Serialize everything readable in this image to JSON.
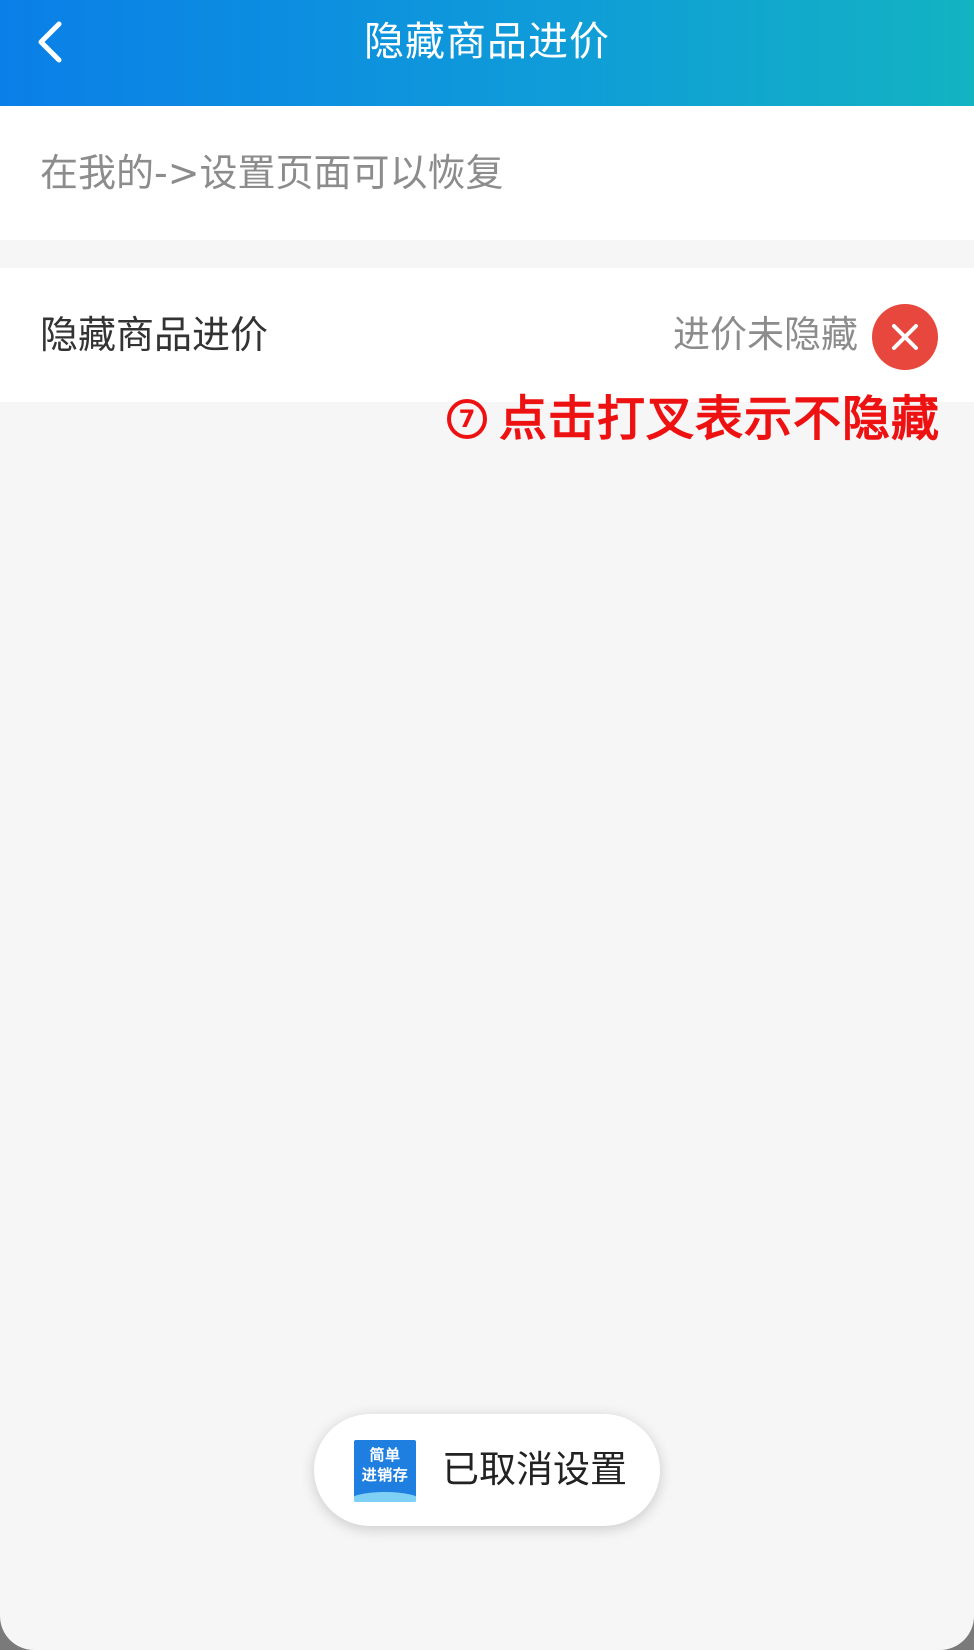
{
  "header": {
    "title": "隐藏商品进价",
    "back_icon": "chevron-left-icon"
  },
  "hint": {
    "text": "在我的->设置页面可以恢复"
  },
  "setting": {
    "label": "隐藏商品进价",
    "status": "进价未隐藏",
    "action_icon": "close-icon",
    "action_color": "#e8473d"
  },
  "annotation": {
    "number": "7",
    "text": "点击打叉表示不隐藏",
    "color": "#ee1111"
  },
  "toast": {
    "logo_line1": "简单",
    "logo_line2": "进销存",
    "message": "已取消设置"
  },
  "colors": {
    "header_start": "#0a7fe8",
    "header_end": "#13b3c2",
    "background": "#f6f6f6"
  }
}
